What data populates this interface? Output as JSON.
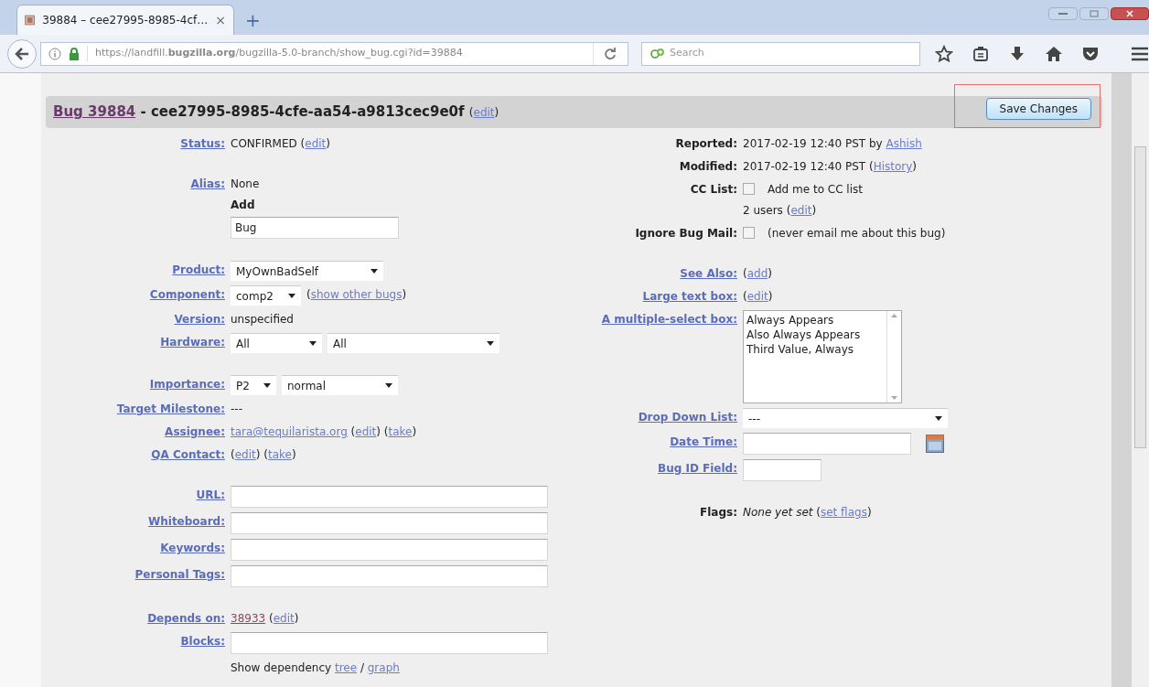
{
  "browser": {
    "tab": {
      "title": "39884 – cee27995-8985-4cf…",
      "close": "×"
    },
    "new_tab": "+",
    "url": "https://landfill.**bugzilla.org**/bugzilla-5.0-branch/show_bug.cgi?id=39884",
    "search_placeholder": "Search"
  },
  "header": {
    "bug_link": "Bug 39884",
    "summary": "- cee27995-8985-4cfe-aa54-a9813cec9e0f",
    "edit_segments": [
      {
        "text": "("
      },
      {
        "link": "edit"
      },
      {
        "text": ")"
      }
    ],
    "save_button": "Save Changes"
  },
  "left_sections": [
    [
      {
        "label": "Status:",
        "linked": true,
        "lines": [
          [
            {
              "kind": "text",
              "segments": [
                {
                  "text": "CONFIRMED ("
                },
                {
                  "link": "edit"
                },
                {
                  "text": ")"
                }
              ]
            }
          ]
        ]
      }
    ],
    [
      {
        "label": "Alias:",
        "linked": true,
        "lines": [
          [
            {
              "kind": "text",
              "segments": [
                {
                  "text": "None"
                }
              ]
            }
          ],
          [
            {
              "kind": "text",
              "segments": [
                {
                  "strong": "Add"
                }
              ]
            }
          ],
          [
            {
              "kind": "input",
              "value": "Bug"
            }
          ]
        ]
      }
    ],
    [
      {
        "label": "Product:",
        "linked": true,
        "lines": [
          [
            {
              "kind": "select",
              "value": "MyOwnBadSelf"
            }
          ]
        ]
      },
      {
        "label": "Component:",
        "linked": true,
        "lines": [
          [
            {
              "kind": "select",
              "value": "comp2"
            },
            {
              "kind": "text",
              "segments": [
                {
                  "text": "("
                },
                {
                  "link": "show other bugs"
                },
                {
                  "text": ")"
                }
              ]
            }
          ]
        ]
      },
      {
        "label": "Version:",
        "linked": true,
        "lines": [
          [
            {
              "kind": "text",
              "segments": [
                {
                  "text": "unspecified"
                }
              ]
            }
          ]
        ]
      },
      {
        "label": "Hardware:",
        "linked": true,
        "lines": [
          [
            {
              "kind": "select",
              "value": "All"
            },
            {
              "kind": "select",
              "value": "All"
            }
          ]
        ]
      }
    ],
    [
      {
        "label": "Importance:",
        "linked": true,
        "lines": [
          [
            {
              "kind": "select",
              "value": "P2"
            },
            {
              "kind": "select",
              "value": "normal"
            }
          ]
        ]
      },
      {
        "label": "Target Milestone:",
        "linked": true,
        "lines": [
          [
            {
              "kind": "text",
              "segments": [
                {
                  "text": "---"
                }
              ]
            }
          ]
        ]
      },
      {
        "label": "Assignee:",
        "linked": true,
        "lines": [
          [
            {
              "kind": "text",
              "segments": [
                {
                  "link": "tara@tequilarista.org"
                },
                {
                  "text": " ("
                },
                {
                  "link": "edit"
                },
                {
                  "text": ") ("
                },
                {
                  "link": "take"
                },
                {
                  "text": ")"
                }
              ]
            }
          ]
        ]
      },
      {
        "label": "QA Contact:",
        "linked": true,
        "lines": [
          [
            {
              "kind": "text",
              "segments": [
                {
                  "text": "("
                },
                {
                  "link": "edit"
                },
                {
                  "text": ") ("
                },
                {
                  "link": "take"
                },
                {
                  "text": ")"
                }
              ]
            }
          ]
        ]
      }
    ],
    [
      {
        "label": "URL:",
        "linked": true,
        "lines": [
          [
            {
              "kind": "input"
            }
          ]
        ]
      },
      {
        "label": "Whiteboard:",
        "linked": true,
        "lines": [
          [
            {
              "kind": "input"
            }
          ]
        ]
      },
      {
        "label": "Keywords:",
        "linked": true,
        "lines": [
          [
            {
              "kind": "input"
            }
          ]
        ]
      },
      {
        "label": "Personal Tags:",
        "linked": true,
        "lines": [
          [
            {
              "kind": "input"
            }
          ]
        ]
      }
    ],
    [
      {
        "label": "Depends on:",
        "linked": true,
        "lines": [
          [
            {
              "kind": "text",
              "segments": [
                {
                  "visited": "38933"
                },
                {
                  "text": " ("
                },
                {
                  "link": "edit"
                },
                {
                  "text": ")"
                }
              ]
            }
          ]
        ]
      },
      {
        "label": "Blocks:",
        "linked": true,
        "lines": [
          [
            {
              "kind": "input"
            }
          ]
        ]
      },
      {
        "lines": [
          [
            {
              "kind": "text",
              "segments": [
                {
                  "text": "Show dependency "
                },
                {
                  "link": "tree"
                },
                {
                  "text": " / "
                },
                {
                  "link": "graph"
                }
              ]
            }
          ]
        ]
      }
    ]
  ],
  "right_sections": [
    [
      {
        "label": "Reported:",
        "linked": false,
        "lines": [
          [
            {
              "kind": "text",
              "segments": [
                {
                  "text": "2017-02-19 12:40 PST by "
                },
                {
                  "link": "Ashish"
                }
              ]
            }
          ]
        ]
      },
      {
        "label": "Modified:",
        "linked": false,
        "lines": [
          [
            {
              "kind": "text",
              "segments": [
                {
                  "text": "2017-02-19 12:40 PST ("
                },
                {
                  "link": "History"
                },
                {
                  "text": ")"
                }
              ]
            }
          ]
        ]
      },
      {
        "label": "CC List:",
        "linked": false,
        "lines": [
          [
            {
              "kind": "checkbox",
              "checked": false
            },
            {
              "kind": "text",
              "segments": [
                {
                  "text": "Add me to CC list"
                }
              ]
            }
          ],
          [
            {
              "kind": "text",
              "segments": [
                {
                  "text": "2 users ("
                },
                {
                  "link": "edit"
                },
                {
                  "text": ")"
                }
              ]
            }
          ]
        ]
      },
      {
        "label": "Ignore Bug Mail:",
        "linked": false,
        "lines": [
          [
            {
              "kind": "checkbox",
              "checked": false
            },
            {
              "kind": "text",
              "segments": [
                {
                  "text": "(never email me about this bug)"
                }
              ]
            }
          ]
        ]
      }
    ],
    [
      {
        "label": "See Also:",
        "linked": true,
        "lines": [
          [
            {
              "kind": "text",
              "segments": [
                {
                  "text": "("
                },
                {
                  "link": "add"
                },
                {
                  "text": ")"
                }
              ]
            }
          ]
        ]
      },
      {
        "label": "Large text box:",
        "linked": true,
        "lines": [
          [
            {
              "kind": "text",
              "segments": [
                {
                  "text": "("
                },
                {
                  "link": "edit"
                },
                {
                  "text": ")"
                }
              ]
            }
          ]
        ]
      },
      {
        "label": "A multiple-select box:",
        "linked": true,
        "lines": [
          [
            {
              "kind": "multiselect",
              "options": [
                {
                  "text": "Always Appears",
                  "selected": false
                },
                {
                  "text": "Also Always Appears",
                  "selected": false
                },
                {
                  "text": "Third Value, Always",
                  "selected": false
                }
              ]
            }
          ]
        ]
      },
      {
        "label": "Drop Down List:",
        "linked": true,
        "lines": [
          [
            {
              "kind": "select",
              "value": "---"
            }
          ]
        ]
      },
      {
        "label": "Date Time:",
        "linked": true,
        "lines": [
          [
            {
              "kind": "input"
            },
            {
              "kind": "calendar"
            }
          ]
        ]
      },
      {
        "label": "Bug ID Field:",
        "linked": true,
        "lines": [
          [
            {
              "kind": "input"
            }
          ]
        ]
      }
    ],
    [
      {
        "label": "Flags:",
        "linked": false,
        "lines": [
          [
            {
              "kind": "text",
              "segments": [
                {
                  "em": "None yet set"
                },
                {
                  "text": " ("
                },
                {
                  "link": "set flags"
                },
                {
                  "text": ")"
                }
              ]
            }
          ]
        ]
      }
    ]
  ]
}
